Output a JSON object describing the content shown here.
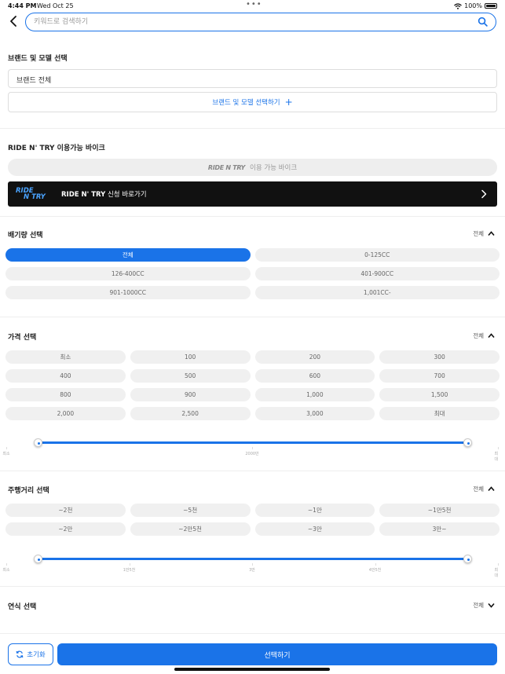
{
  "status_bar": {
    "time": "4:44 PM",
    "date": "Wed Oct 25",
    "battery": "100%"
  },
  "search": {
    "placeholder": "키워드로 검색하기"
  },
  "brand_section": {
    "title": "브랜드 및 모델 선택",
    "field_value": "브랜드 전체",
    "select_button": "브랜드 및 모델 선택하기"
  },
  "ridetry_section": {
    "title": "RIDE N' TRY 이용가능 바이크",
    "pill_logo": "RIDE N TRY",
    "pill_text": "이용 가능 바이크",
    "banner_logo_top": "RIDE",
    "banner_logo_bottom": "N TRY",
    "banner_bold": "RIDE N' TRY",
    "banner_text": " 신청 바로가기"
  },
  "displacement_section": {
    "title": "배기량 선택",
    "toggle_label": "전체",
    "options": [
      "전체",
      "0-125CC",
      "126-400CC",
      "401-900CC",
      "901-1000CC",
      "1,001CC-"
    ],
    "selected_index": 0
  },
  "price_section": {
    "title": "가격 선택",
    "toggle_label": "전체",
    "options": [
      "최소",
      "100",
      "200",
      "300",
      "400",
      "500",
      "600",
      "700",
      "800",
      "900",
      "1,000",
      "1,500",
      "2,000",
      "2,500",
      "3,000",
      "최대"
    ],
    "slider_labels": [
      "최소",
      "2000만",
      "최대"
    ],
    "slider_range": [
      0,
      1
    ]
  },
  "mileage_section": {
    "title": "주행거리 선택",
    "toggle_label": "전체",
    "options": [
      "~2천",
      "~5천",
      "~1만",
      "~1만5천",
      "~2만",
      "~2만5천",
      "~3만",
      "3만~"
    ],
    "slider_labels": [
      "최소",
      "1만5천",
      "3만",
      "4만5천",
      "최대"
    ],
    "slider_range": [
      0,
      1
    ]
  },
  "year_section": {
    "title": "연식 선택",
    "toggle_label": "전체"
  },
  "bottom_bar": {
    "reset_label": "초기화",
    "apply_label": "선택하기"
  },
  "colors": {
    "accent": "#1a73e8",
    "chip_bg": "#f0f0f0",
    "banner_bg": "#111111"
  }
}
